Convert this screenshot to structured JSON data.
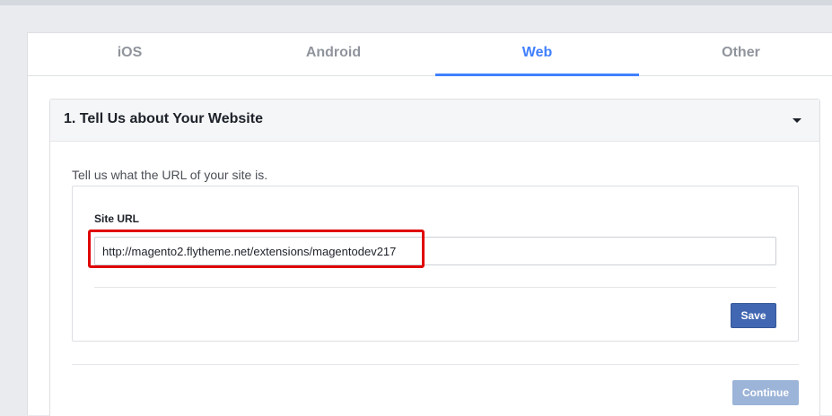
{
  "tabs": [
    {
      "label": "iOS",
      "active": false
    },
    {
      "label": "Android",
      "active": false
    },
    {
      "label": "Web",
      "active": true
    },
    {
      "label": "Other",
      "active": false
    }
  ],
  "section": {
    "title": "1. Tell Us about Your Website",
    "intro": "Tell us what the URL of your site is.",
    "field_label": "Site URL",
    "site_url_value": "http://magento2.flytheme.net/extensions/magentodev217",
    "save_label": "Save",
    "collapse_icon": "caret-down-icon"
  },
  "footer": {
    "continue_label": "Continue"
  },
  "colors": {
    "accent": "#4080ff",
    "primary_button": "#4267b2",
    "disabled_button": "#9cb4d8",
    "highlight": "#e00000"
  }
}
